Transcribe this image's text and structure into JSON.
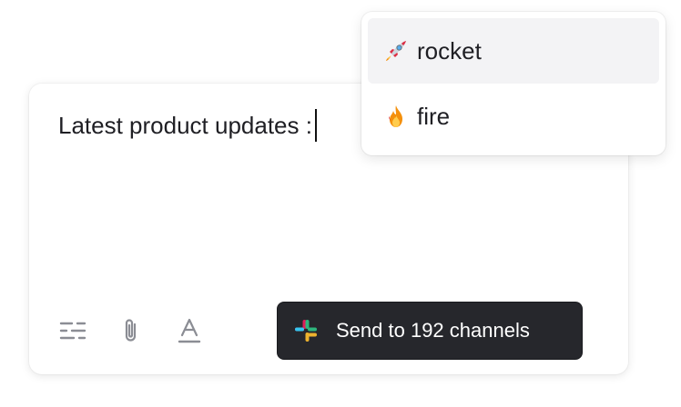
{
  "composer": {
    "message_text": "Latest product updates :",
    "toolbar": {
      "formatting_icon": "sliders-icon",
      "attach_icon": "paperclip-icon",
      "text_style_icon": "text-format-icon"
    },
    "send_button_label": "Send to 192 channels",
    "send_button_icon": "slack-logo-icon"
  },
  "emoji_dropdown": {
    "items": [
      {
        "emoji": "rocket-emoji",
        "label": "rocket",
        "selected": true
      },
      {
        "emoji": "fire-emoji",
        "label": "fire",
        "selected": false
      }
    ]
  },
  "colors": {
    "send_button_bg": "#26272c",
    "selected_item_bg": "#f3f3f5",
    "icon_gray": "#8b8d94"
  }
}
